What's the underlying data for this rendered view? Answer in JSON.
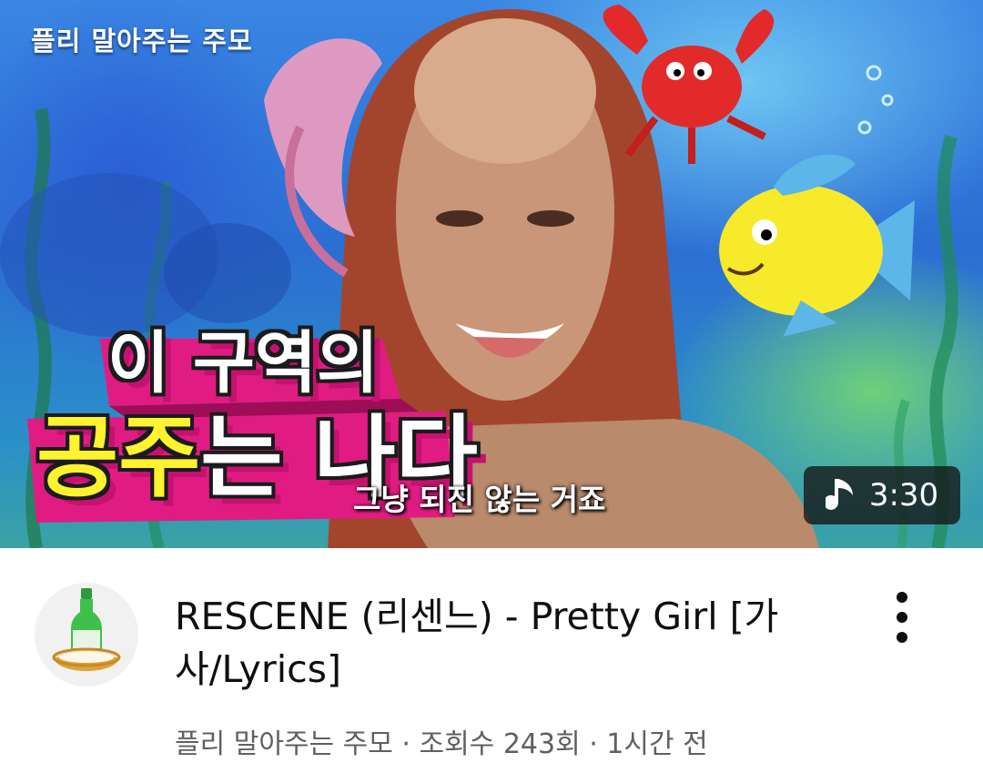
{
  "video": {
    "thumbnail": {
      "watermark": "플리 말아주는 주모",
      "caption_line1": "이 구역의",
      "caption_line2_yellow": "공주",
      "caption_line2_white": "는 나다",
      "subtitle": "그냥 되진 않는 거죠",
      "duration": "3:30",
      "duration_icon": "music-note-icon"
    },
    "channel_avatar_icon": "soju-bottle-bowl-icon",
    "title": "RESCENE (리센느) - Pretty Girl [가사/Lyrics]",
    "meta": "플리 말아주는 주모 · 조회수 243회 · 1시간 전",
    "more_icon": "more-vert-icon"
  },
  "colors": {
    "caption_yellow": "#fff22e",
    "caption_pink": "#c4126e",
    "meta_gray": "#606060"
  }
}
